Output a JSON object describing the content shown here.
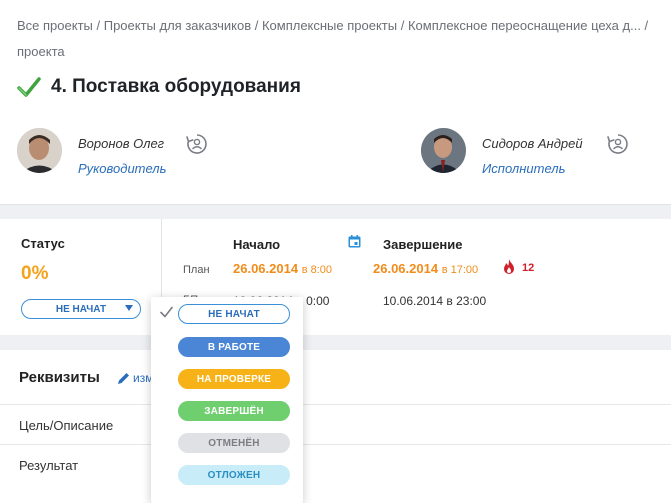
{
  "breadcrumb": {
    "items": [
      "Все проекты",
      "Проекты для заказчиков",
      "Комплексные проекты",
      "Комплексное переоснащение цеха д..."
    ],
    "separator": " / ",
    "trailing": "проекта"
  },
  "page": {
    "title": "4. Поставка оборудования",
    "icon": "check-icon"
  },
  "people": [
    {
      "name": "Воронов Олег",
      "role": "Руководитель"
    },
    {
      "name": "Сидоров Андрей",
      "role": "Исполнитель"
    }
  ],
  "status": {
    "label": "Статус",
    "percent": "0%",
    "current": "НЕ НАЧАТ"
  },
  "schedule": {
    "start_header": "Начало",
    "end_header": "Завершение",
    "plan_label": "План",
    "fact_label": "БП",
    "plan_start_date": "26.06.2014",
    "plan_start_time": "в 8:00",
    "plan_end_date": "26.06.2014",
    "plan_end_time": "в 17:00",
    "fact_start": "10.06.2014 в 0:00",
    "fact_end": "10.06.2014 в 23:00",
    "overdue_days": "12"
  },
  "details": {
    "title": "Реквизиты",
    "edit_label": "изм",
    "rows": [
      "Цель/Описание",
      "Результат"
    ]
  },
  "status_options": [
    {
      "label": "НЕ НАЧАТ",
      "bg": "#ffffff",
      "color": "#2a6ebb",
      "border": "#3a8fd9",
      "selected": true
    },
    {
      "label": "В РАБОТЕ",
      "bg": "#4b86d6",
      "color": "#ffffff",
      "border": "#4b86d6",
      "selected": false
    },
    {
      "label": "НА ПРОВЕРКЕ",
      "bg": "#f7b218",
      "color": "#ffffff",
      "border": "#f7b218",
      "selected": false
    },
    {
      "label": "ЗАВЕРШЁН",
      "bg": "#6fcf6f",
      "color": "#ffffff",
      "border": "#6fcf6f",
      "selected": false
    },
    {
      "label": "ОТМЕНЁН",
      "bg": "#dfe1e4",
      "color": "#7a7e84",
      "border": "#dfe1e4",
      "selected": false
    },
    {
      "label": "ОТЛОЖЕН",
      "bg": "#c8ecf8",
      "color": "#2a8fc1",
      "border": "#c8ecf8",
      "selected": false
    }
  ],
  "colors": {
    "accent": "#2a6ebb",
    "orange": "#f08c1a",
    "danger": "#d0202a"
  }
}
